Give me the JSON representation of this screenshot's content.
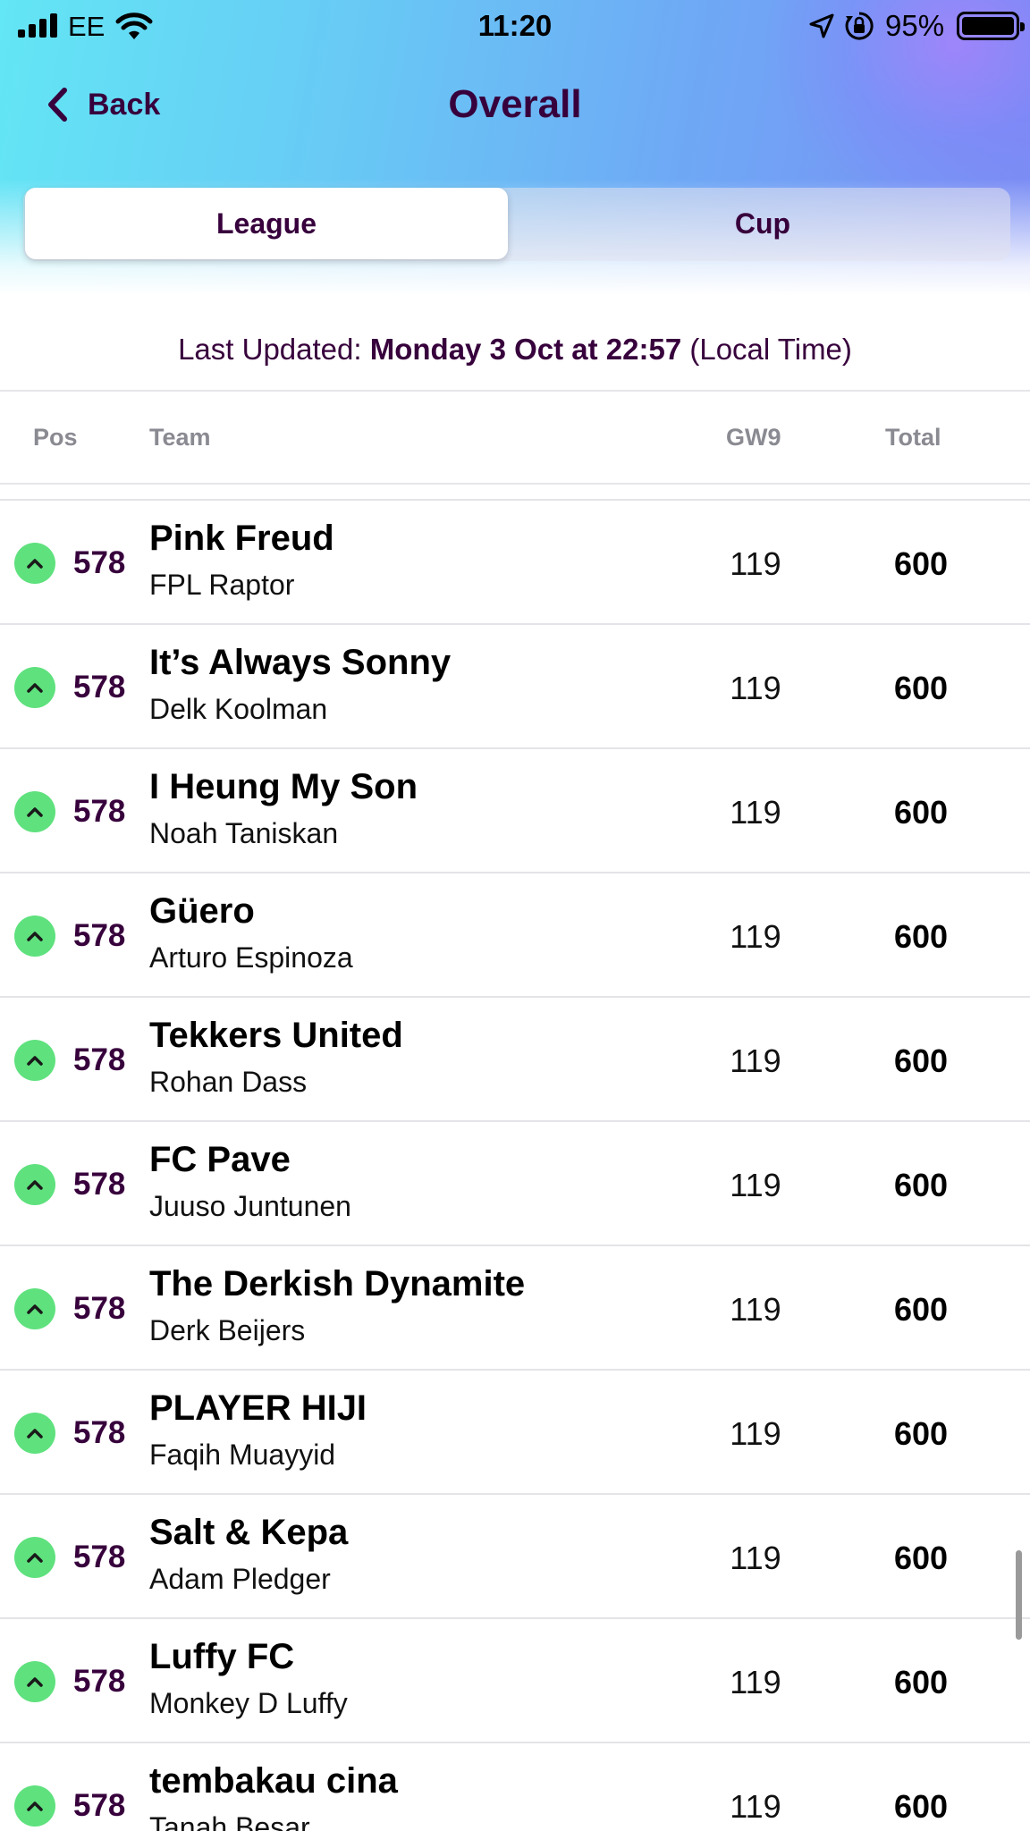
{
  "status_bar": {
    "carrier": "EE",
    "time": "11:20",
    "battery": "95%"
  },
  "nav": {
    "back_label": "Back",
    "title": "Overall"
  },
  "tabs": [
    {
      "label": "League",
      "active": true
    },
    {
      "label": "Cup",
      "active": false
    }
  ],
  "last_updated": {
    "prefix": "Last Updated: ",
    "value": "Monday 3 Oct at 22:57",
    "suffix": " (Local Time)"
  },
  "columns": {
    "pos": "Pos",
    "team": "Team",
    "gw": "GW9",
    "total": "Total"
  },
  "rows": [
    {
      "pos": "578",
      "team": "Pink Freud",
      "manager": "FPL Raptor",
      "gw": "119",
      "total": "600"
    },
    {
      "pos": "578",
      "team": "It’s Always Sonny",
      "manager": "Delk Koolman",
      "gw": "119",
      "total": "600"
    },
    {
      "pos": "578",
      "team": "I Heung My Son",
      "manager": "Noah Taniskan",
      "gw": "119",
      "total": "600"
    },
    {
      "pos": "578",
      "team": "Güero",
      "manager": "Arturo Espinoza",
      "gw": "119",
      "total": "600"
    },
    {
      "pos": "578",
      "team": "Tekkers United",
      "manager": "Rohan Dass",
      "gw": "119",
      "total": "600"
    },
    {
      "pos": "578",
      "team": "FC Pave",
      "manager": "Juuso Juntunen",
      "gw": "119",
      "total": "600"
    },
    {
      "pos": "578",
      "team": "The Derkish Dynamite",
      "manager": "Derk Beijers",
      "gw": "119",
      "total": "600"
    },
    {
      "pos": "578",
      "team": "PLAYER HIJI",
      "manager": "Faqih Muayyid",
      "gw": "119",
      "total": "600"
    },
    {
      "pos": "578",
      "team": "Salt & Kepa",
      "manager": "Adam Pledger",
      "gw": "119",
      "total": "600"
    },
    {
      "pos": "578",
      "team": "Luffy FC",
      "manager": "Monkey D Luffy",
      "gw": "119",
      "total": "600"
    },
    {
      "pos": "578",
      "team": "tembakau cina",
      "manager": "Tanah Besar",
      "gw": "119",
      "total": "600"
    }
  ],
  "icons": {
    "movement": "chevron-up-icon",
    "back": "chevron-left-icon"
  },
  "colors": {
    "brand_purple": "#37003c",
    "movement_up": "#5fe17e"
  }
}
